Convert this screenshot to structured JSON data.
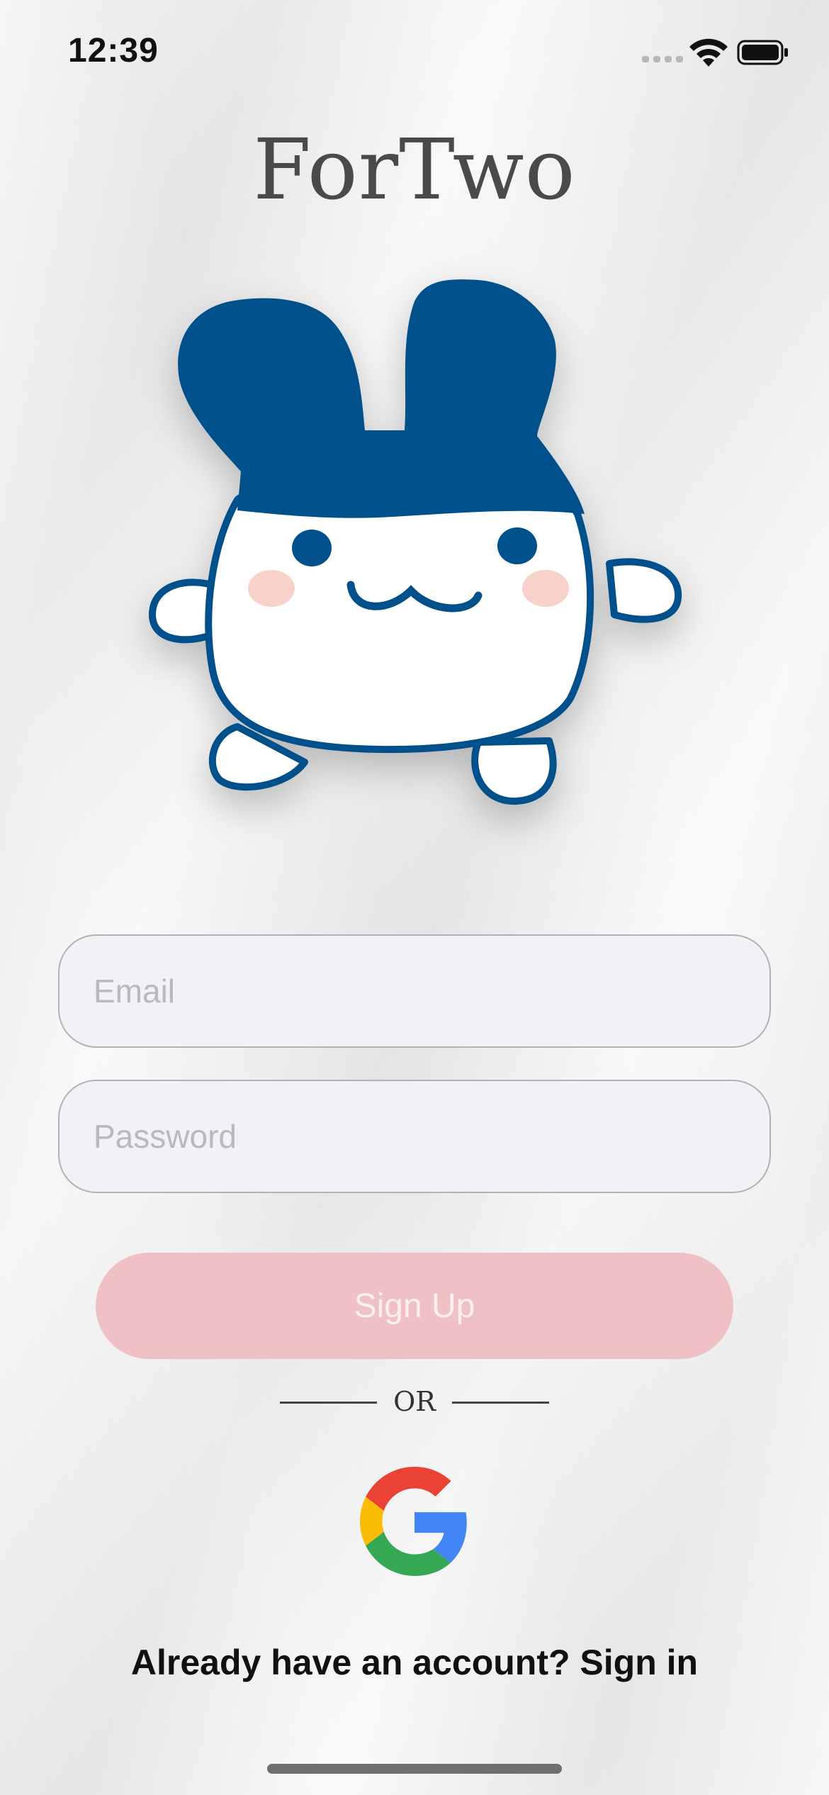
{
  "status_bar": {
    "time": "12:39",
    "icons": [
      "signal-icon",
      "wifi-icon",
      "battery-icon"
    ]
  },
  "app": {
    "title": "ForTwo",
    "mascot": "blue-eared-mascot"
  },
  "form": {
    "email_placeholder": "Email",
    "password_placeholder": "Password",
    "signup_label": "Sign Up"
  },
  "divider": {
    "label": "OR"
  },
  "social": {
    "google_icon": "google-icon"
  },
  "footer": {
    "signin_prompt": "Already have an account? Sign in"
  },
  "colors": {
    "accent_blue": "#00508c",
    "signup_button": "#efc0c4",
    "cheek_pink": "#f9d1cb",
    "title_gray": "#4a4a4a"
  }
}
